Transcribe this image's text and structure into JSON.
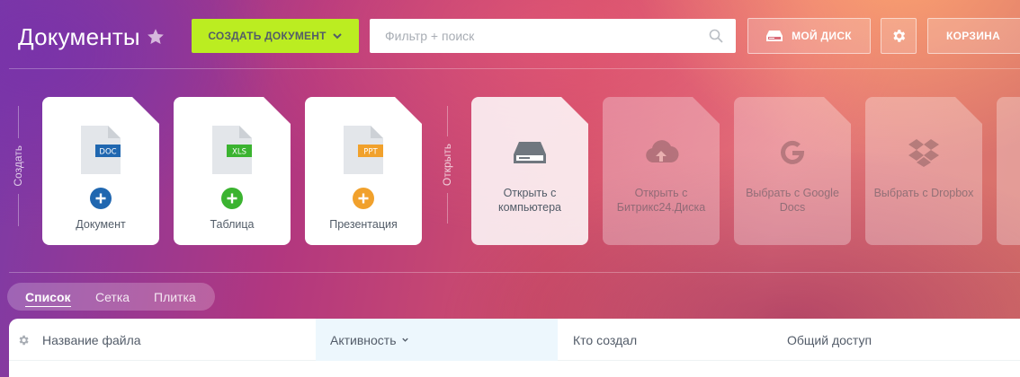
{
  "header": {
    "title": "Документы",
    "create_button": "СОЗДАТЬ ДОКУМЕНТ",
    "search_placeholder": "Фильтр + поиск",
    "my_disk_button": "МОЙ ДИСК",
    "trash_button": "КОРЗИНА"
  },
  "sections": {
    "create_label": "Создать",
    "open_label": "Открыть"
  },
  "create_tiles": [
    {
      "label": "Документ",
      "badge": "DOC",
      "color": "#2067b0"
    },
    {
      "label": "Таблица",
      "badge": "XLS",
      "color": "#3bb330"
    },
    {
      "label": "Презентация",
      "badge": "PPT",
      "color": "#f1a12c"
    }
  ],
  "open_tiles": [
    {
      "label": "Открыть с компьютера",
      "icon": "hard-drive-icon",
      "enabled": true
    },
    {
      "label": "Открыть с Битрикс24.Диска",
      "icon": "cloud-upload-icon",
      "enabled": false
    },
    {
      "label": "Выбрать с Google Docs",
      "icon": "google-icon",
      "enabled": false
    },
    {
      "label": "Выбрать с Dropbox",
      "icon": "dropbox-icon",
      "enabled": false
    }
  ],
  "view_switch": {
    "items": [
      "Список",
      "Сетка",
      "Плитка"
    ],
    "active": "Список"
  },
  "table": {
    "columns": [
      "Название файла",
      "Активность",
      "Кто создал",
      "Общий доступ"
    ],
    "sorted_column": "Активность"
  },
  "colors": {
    "accent_green": "#bbed21",
    "file_gray": "#e3e6ea",
    "icon_gray": "#80868e"
  }
}
